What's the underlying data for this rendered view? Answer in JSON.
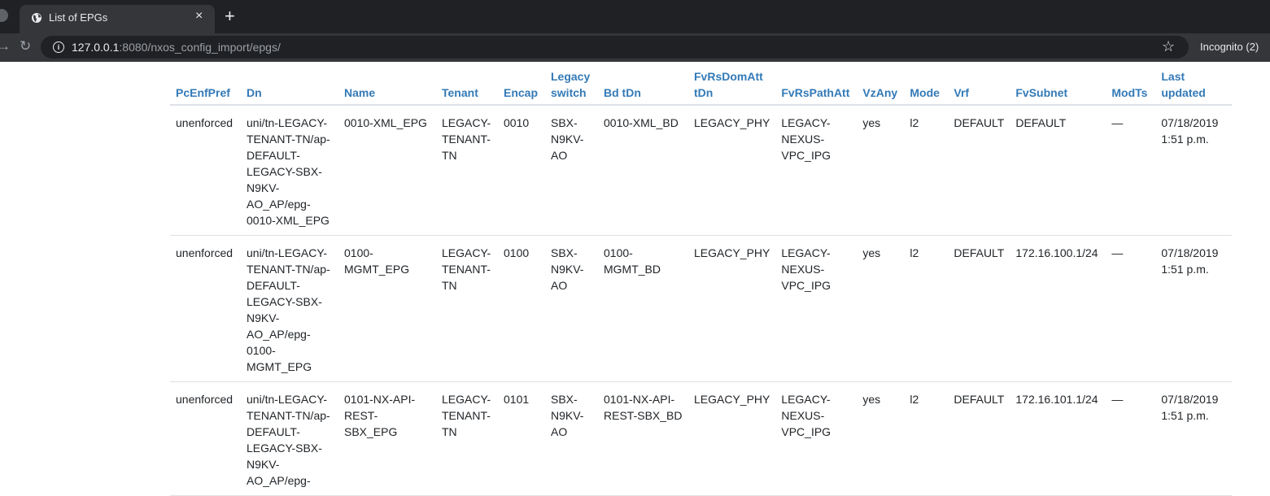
{
  "browser": {
    "tab_title": "List of EPGs",
    "tab_close": "×",
    "new_tab": "+",
    "url_host": "127.0.0.1",
    "url_path": ":8080/nxos_config_import/epgs/",
    "profile_label": "Incognito (2)",
    "icons": [
      "globe-icon",
      "close-icon",
      "plus-icon",
      "back-icon",
      "reload-icon",
      "info-icon",
      "star-icon"
    ]
  },
  "table": {
    "headers": {
      "pcenfpref": "PcEnfPref",
      "dn": "Dn",
      "name": "Name",
      "tenant": "Tenant",
      "encap": "Encap",
      "legacy_switch": "Legacy switch",
      "bd_tdn": "Bd tDn",
      "fvrsdomatt_tdn": "FvRsDomAtt tDn",
      "fvrspathatt": "FvRsPathAtt",
      "vzany": "VzAny",
      "mode": "Mode",
      "vrf": "Vrf",
      "fvsubnet": "FvSubnet",
      "modts": "ModTs",
      "last_updated": "Last updated"
    },
    "rows": [
      {
        "pcenfpref": "unenforced",
        "dn": "uni/tn-LEGACY-TENANT-TN/ap-DEFAULT-LEGACY-SBX-N9KV-AO_AP/epg-0010-XML_EPG",
        "name": "0010-XML_EPG",
        "tenant": "LEGACY-TENANT-TN",
        "encap": "0010",
        "legacy_switch": "SBX-N9KV-AO",
        "bd_tdn": "0010-XML_BD",
        "fvrsdomatt_tdn": "LEGACY_PHY",
        "fvrspathatt": "LEGACY-NEXUS-VPC_IPG",
        "vzany": "yes",
        "mode": "l2",
        "vrf": "DEFAULT",
        "fvsubnet": "DEFAULT",
        "modts": "—",
        "last_updated": "07/18/2019 1:51 p.m."
      },
      {
        "pcenfpref": "unenforced",
        "dn": "uni/tn-LEGACY-TENANT-TN/ap-DEFAULT-LEGACY-SBX-N9KV-AO_AP/epg-0100-MGMT_EPG",
        "name": "0100-MGMT_EPG",
        "tenant": "LEGACY-TENANT-TN",
        "encap": "0100",
        "legacy_switch": "SBX-N9KV-AO",
        "bd_tdn": "0100-MGMT_BD",
        "fvrsdomatt_tdn": "LEGACY_PHY",
        "fvrspathatt": "LEGACY-NEXUS-VPC_IPG",
        "vzany": "yes",
        "mode": "l2",
        "vrf": "DEFAULT",
        "fvsubnet": "172.16.100.1/24",
        "modts": "—",
        "last_updated": "07/18/2019 1:51 p.m."
      },
      {
        "pcenfpref": "unenforced",
        "dn": "uni/tn-LEGACY-TENANT-TN/ap-DEFAULT-LEGACY-SBX-N9KV-AO_AP/epg-",
        "name": "0101-NX-API-REST-SBX_EPG",
        "tenant": "LEGACY-TENANT-TN",
        "encap": "0101",
        "legacy_switch": "SBX-N9KV-AO",
        "bd_tdn": "0101-NX-API-REST-SBX_BD",
        "fvrsdomatt_tdn": "LEGACY_PHY",
        "fvrspathatt": "LEGACY-NEXUS-VPC_IPG",
        "vzany": "yes",
        "mode": "l2",
        "vrf": "DEFAULT",
        "fvsubnet": "172.16.101.1/24",
        "modts": "—",
        "last_updated": "07/18/2019 1:51 p.m."
      }
    ]
  }
}
